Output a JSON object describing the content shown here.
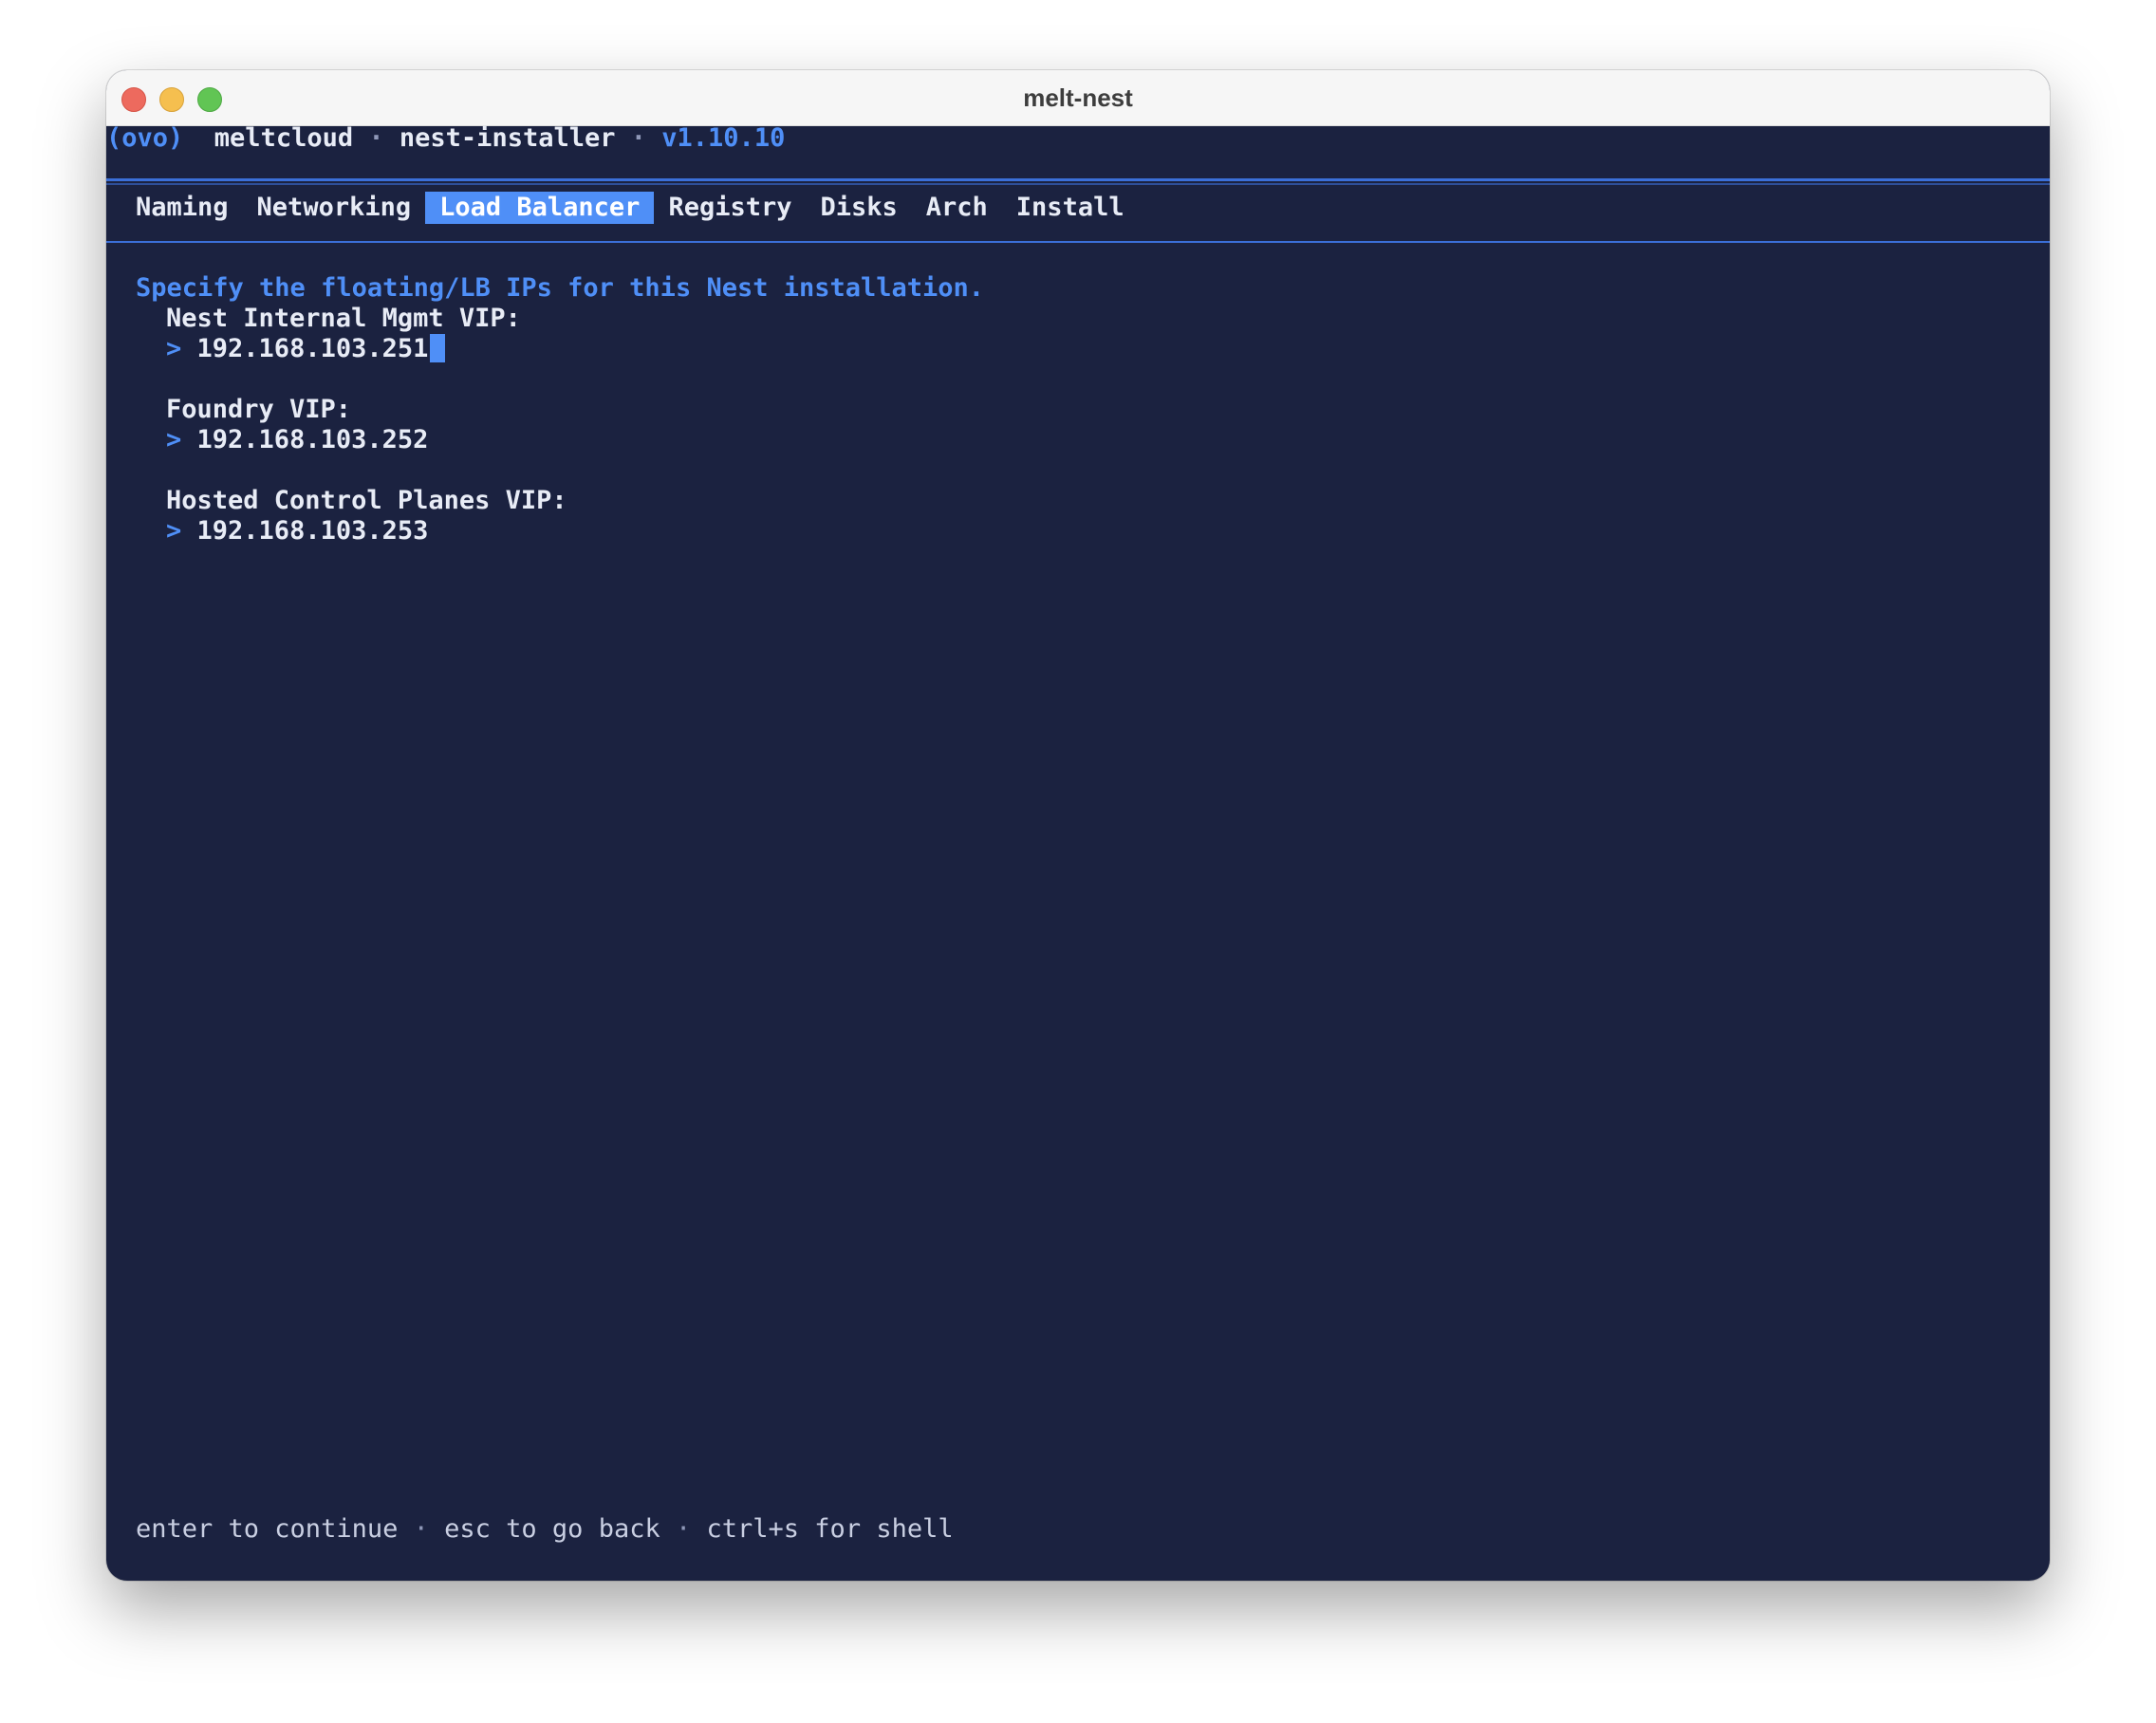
{
  "window": {
    "title": "melt-nest"
  },
  "header": {
    "logo": "(ovo)",
    "app": "meltcloud",
    "sep": "·",
    "module": "nest-installer",
    "version": "v1.10.10"
  },
  "tabs": [
    {
      "label": "Naming",
      "active": false
    },
    {
      "label": "Networking",
      "active": false
    },
    {
      "label": "Load Balancer",
      "active": true
    },
    {
      "label": "Registry",
      "active": false
    },
    {
      "label": "Disks",
      "active": false
    },
    {
      "label": "Arch",
      "active": false
    },
    {
      "label": "Install",
      "active": false
    }
  ],
  "form": {
    "prompt": "Specify the floating/LB IPs for this Nest installation.",
    "prompt_char": ">",
    "fields": [
      {
        "label": "Nest Internal Mgmt VIP:",
        "value": "192.168.103.251",
        "focused": true
      },
      {
        "label": "Foundry VIP:",
        "value": "192.168.103.252",
        "focused": false
      },
      {
        "label": "Hosted Control Planes VIP:",
        "value": "192.168.103.253",
        "focused": false
      }
    ]
  },
  "footer": {
    "hint_continue": "enter to continue",
    "hint_back": "esc to go back",
    "hint_shell": "ctrl+s for shell",
    "sep": "·"
  },
  "colors": {
    "background": "#1b2240",
    "accent": "#4f8ff7",
    "text": "#e8ecf6"
  }
}
